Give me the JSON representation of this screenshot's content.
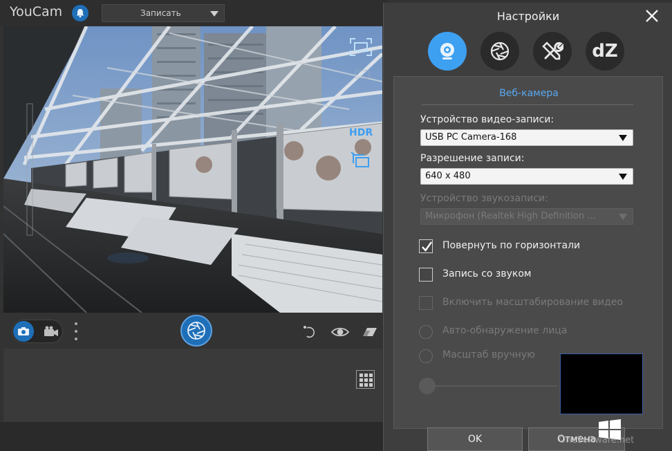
{
  "app": {
    "title": "YouCam",
    "mode_select": {
      "value": "Записать"
    }
  },
  "preview": {
    "hdr_label": "HDR"
  },
  "dialog": {
    "title": "Настройки",
    "tabs": [
      {
        "name": "webcam",
        "icon": "webcam-icon",
        "active": true
      },
      {
        "name": "capture",
        "icon": "aperture-icon",
        "active": false
      },
      {
        "name": "tools",
        "icon": "tools-icon",
        "active": false
      },
      {
        "name": "dz",
        "label": "dZ",
        "active": false
      }
    ],
    "section_heading": "Веб-камера",
    "video_device": {
      "label": "Устройство видео-записи:",
      "value": "USB PC Camera-168"
    },
    "resolution": {
      "label": "Разрешение записи:",
      "value": "640 x 480"
    },
    "audio_device": {
      "label": "Устройство звукозаписи:",
      "value": "Микрофон (Realtek High Definition ..."
    },
    "flip_horizontal": {
      "label": "Повернуть по горизонтали",
      "checked": true
    },
    "record_audio": {
      "label": "Запись со звуком",
      "checked": false
    },
    "enable_zoom": {
      "label": "Включить масштабирование видео",
      "checked": false
    },
    "face_detect": {
      "label": "Авто-обнаружение лица"
    },
    "manual_zoom": {
      "label": "Масштаб вручную"
    },
    "ok_label": "OK",
    "cancel_label": "Отмена"
  },
  "watermark": "OneSoftware.net",
  "colors": {
    "accent": "#3ea0f0",
    "link": "#5aa8ee",
    "panel": "#4a4a4a"
  }
}
